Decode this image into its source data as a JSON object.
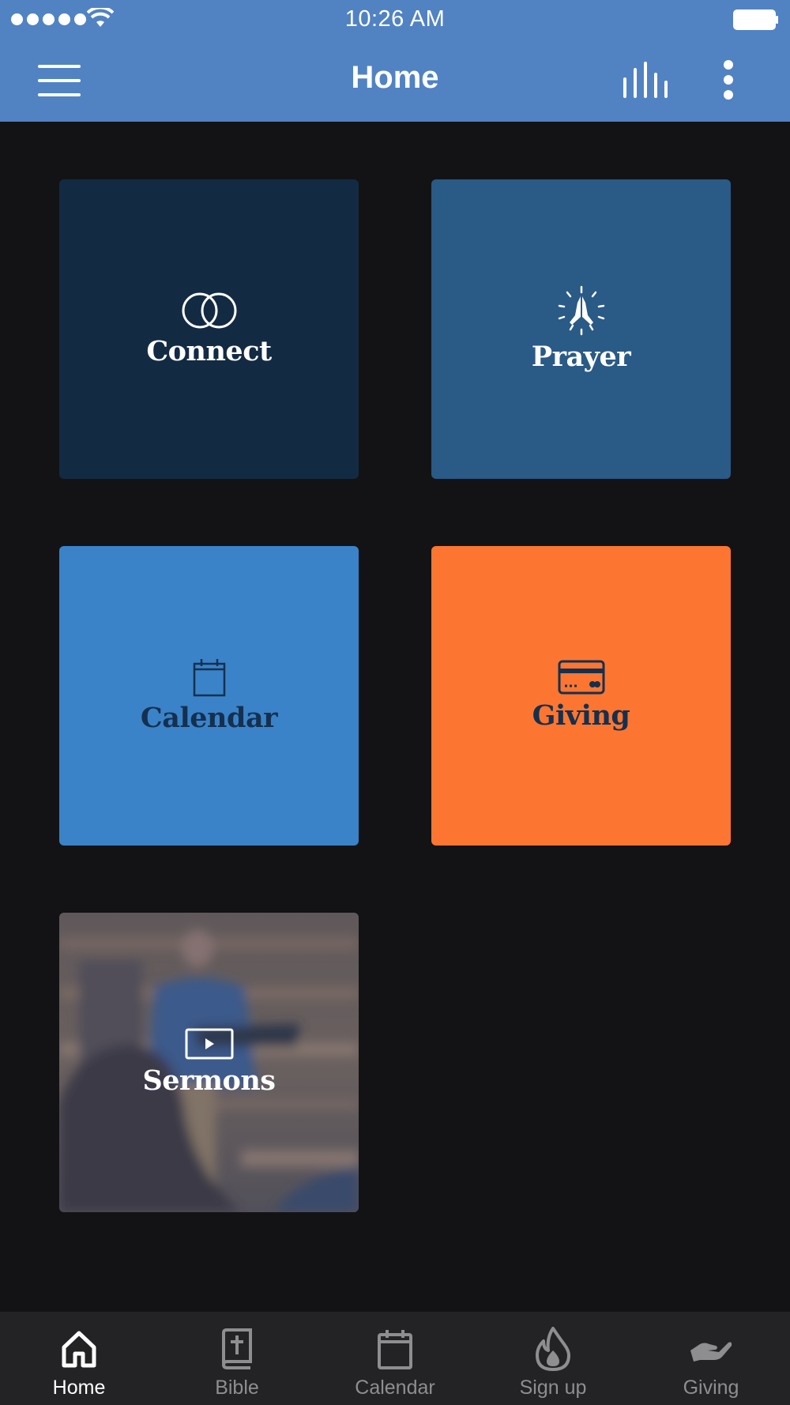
{
  "status_bar": {
    "time": "10:26 AM"
  },
  "header": {
    "title": "Home",
    "background_color": "#5183c3",
    "menu_icon": "hamburger-menu-icon",
    "stats_icon": "bar-chart-icon",
    "more_icon": "more-vertical-icon"
  },
  "tiles": [
    {
      "label": "Connect",
      "icon": "rings-icon",
      "color": "#132a43"
    },
    {
      "label": "Prayer",
      "icon": "praying-hands-icon",
      "color": "#2a5a86"
    },
    {
      "label": "Calendar",
      "icon": "calendar-icon",
      "color": "#3a83c8"
    },
    {
      "label": "Giving",
      "icon": "credit-card-icon",
      "color": "#fc7631"
    },
    {
      "label": "Sermons",
      "icon": "video-play-icon",
      "color": "photo"
    }
  ],
  "bottom_nav": {
    "items": [
      {
        "label": "Home",
        "icon": "home-icon",
        "active": true
      },
      {
        "label": "Bible",
        "icon": "bible-icon",
        "active": false
      },
      {
        "label": "Calendar",
        "icon": "calendar-icon",
        "active": false
      },
      {
        "label": "Sign up",
        "icon": "flame-icon",
        "active": false
      },
      {
        "label": "Giving",
        "icon": "giving-hand-icon",
        "active": false
      }
    ]
  }
}
